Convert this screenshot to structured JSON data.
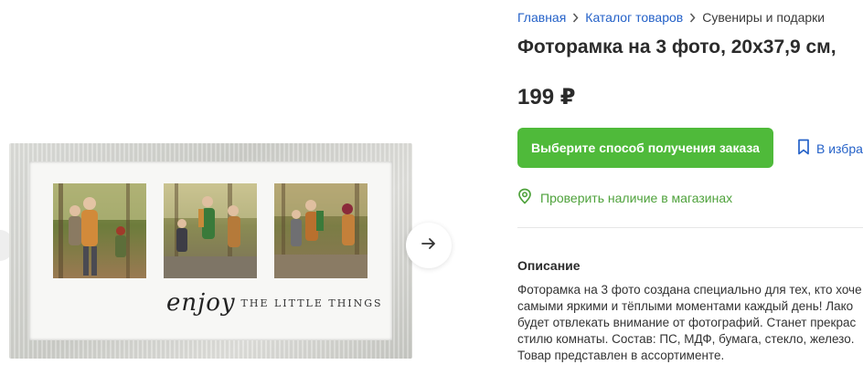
{
  "gallery": {
    "next_arrow_icon": "arrow-right-icon",
    "image_text": {
      "script": "enjoy",
      "caps": "THE LITTLE THINGS"
    }
  },
  "breadcrumb": {
    "items": [
      "Главная",
      "Каталог товаров",
      "Сувениры и подарки"
    ]
  },
  "product": {
    "title": "Фоторамка на 3 фото, 20х37,9 см,",
    "price": "199 ₽"
  },
  "actions": {
    "cta_label": "Выберите способ получения заказа",
    "favorite_label": "В избра",
    "stock_check_label": "Проверить наличие в магазинах"
  },
  "description": {
    "heading": "Описание",
    "lines": [
      "Фоторамка на 3 фото создана специально для тех, кто хоче",
      "самыми яркими и тёплыми моментами каждый день! Лако",
      "будет отвлекать внимание от фотографий. Станет прекрас",
      "стилю комнаты. Состав: ПС, МДФ, бумага, стекло, железо.",
      "Товар представлен в ассортименте."
    ]
  },
  "colors": {
    "accent_green": "#4fba3a",
    "link_blue": "#2461c8",
    "stock_green": "#4fa23c"
  }
}
